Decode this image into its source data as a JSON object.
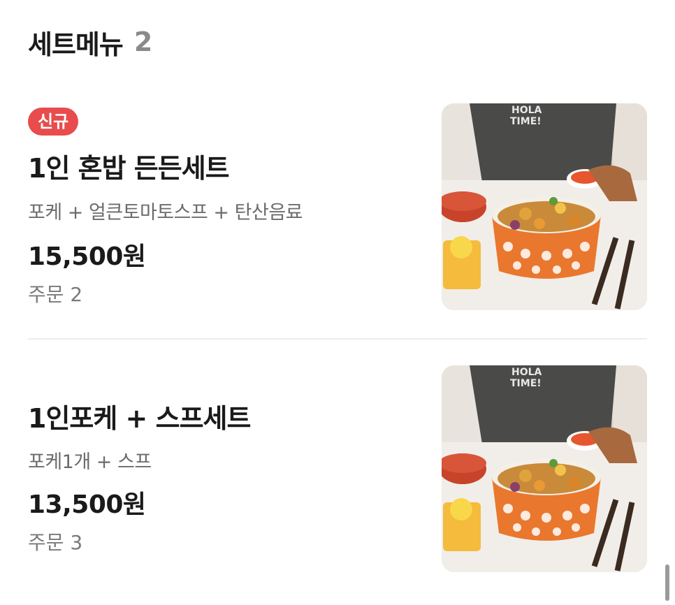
{
  "section": {
    "title": "세트메뉴",
    "count": "2"
  },
  "items": [
    {
      "badge": "신규",
      "name": "1인 혼밥 든든세트",
      "description": "포케 + 얼큰토마토스프 + 탄산음료",
      "price": "15,500원",
      "orders": "주문 2",
      "image_text": "HOLA TIME!"
    },
    {
      "name": "1인포케 + 스프세트",
      "description": "포케1개 + 스프",
      "price": "13,500원",
      "orders": "주문 3",
      "image_text": "HOLA TIME!"
    }
  ],
  "colors": {
    "badge_bg": "#e84c4c",
    "title_text": "#1a1a1a",
    "muted_text": "#7a7a7a",
    "divider": "#ececec"
  }
}
